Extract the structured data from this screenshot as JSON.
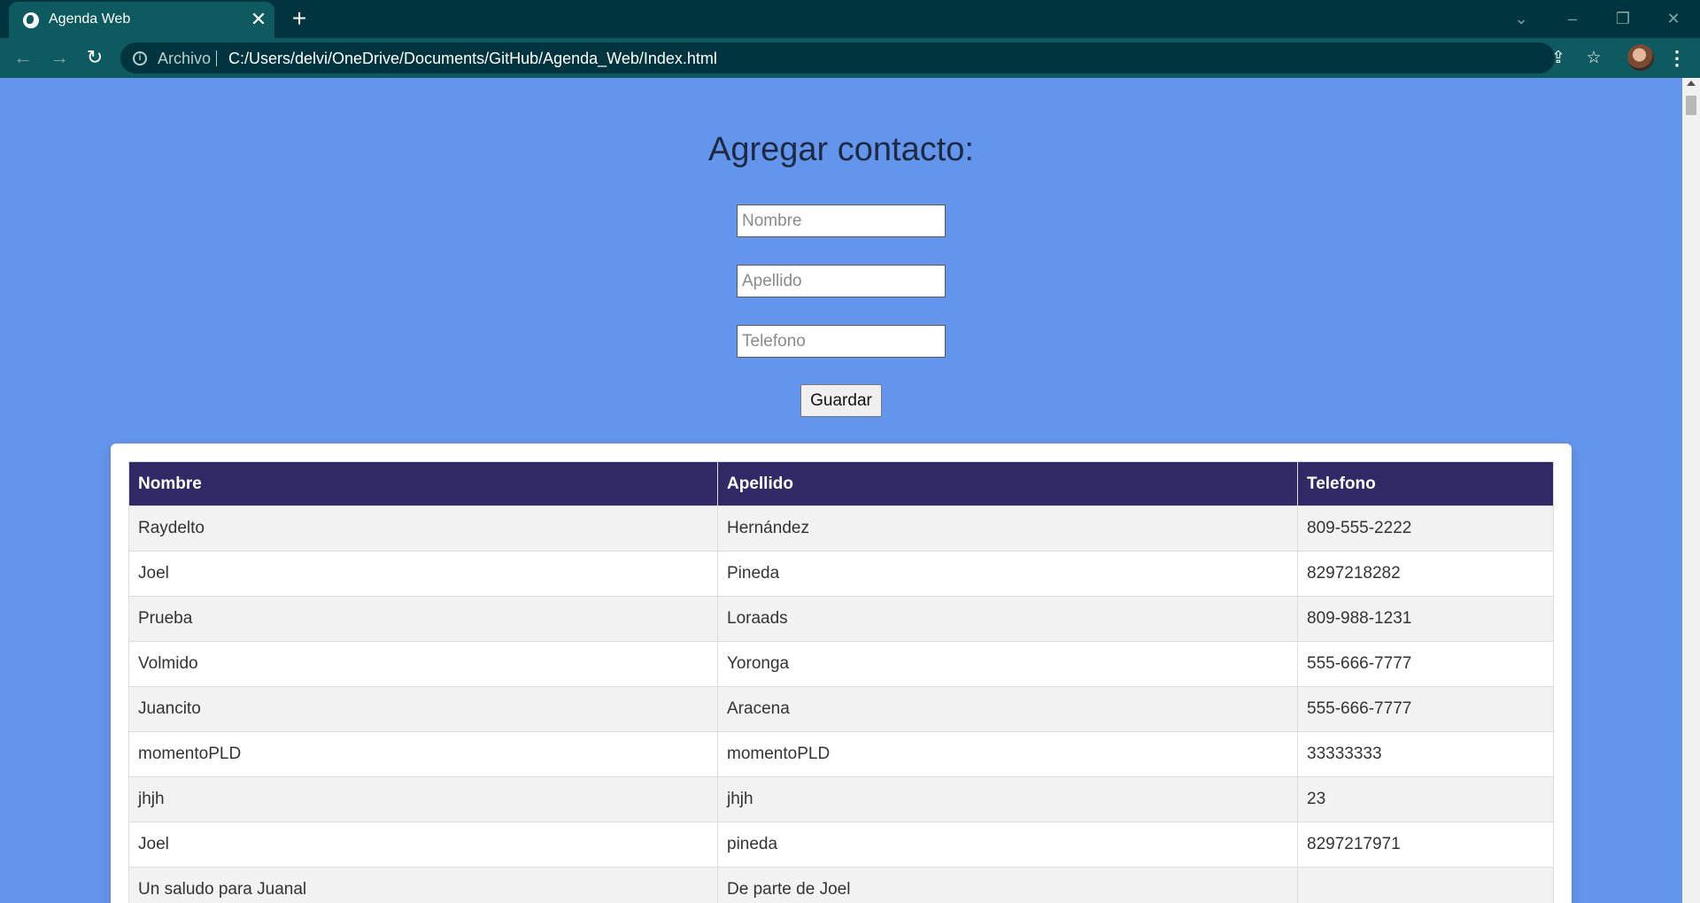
{
  "browser": {
    "tab_title": "Agenda Web",
    "tab_close": "✕",
    "new_tab": "+",
    "address_scheme": "Archivo",
    "address_url": "C:/Users/delvi/OneDrive/Documents/GitHub/Agenda_Web/Index.html",
    "icons": [
      "globe-icon",
      "close-icon",
      "plus-icon",
      "back-icon",
      "forward-icon",
      "reload-icon",
      "info-icon",
      "share-icon",
      "star-icon",
      "avatar",
      "menu-icon",
      "minimize-icon",
      "restore-icon",
      "window-close-icon",
      "tab-search-icon"
    ]
  },
  "form": {
    "heading": "Agregar contacto:",
    "nombre_placeholder": "Nombre",
    "apellido_placeholder": "Apellido",
    "telefono_placeholder": "Telefono",
    "save_label": "Guardar"
  },
  "table": {
    "headers": [
      "Nombre",
      "Apellido",
      "Telefono"
    ],
    "rows": [
      [
        "Raydelto",
        "Hernández",
        "809-555-2222"
      ],
      [
        "Joel",
        "Pineda",
        "8297218282"
      ],
      [
        "Prueba",
        "Loraads",
        "809-988-1231"
      ],
      [
        "Volmido",
        "Yoronga",
        "555-666-7777"
      ],
      [
        "Juancito",
        "Aracena",
        "555-666-7777"
      ],
      [
        "momentoPLD",
        "momentoPLD",
        "33333333"
      ],
      [
        "jhjh",
        "jhjh",
        "23"
      ],
      [
        "Joel",
        "pineda",
        "8297217971"
      ],
      [
        "Un saludo para Juanal",
        "De parte de Joel",
        ""
      ]
    ]
  },
  "colors": {
    "page_background": "#6495ed",
    "table_header": "#302966",
    "chrome_dark": "#00343f",
    "chrome_tab": "#0e5a61"
  }
}
